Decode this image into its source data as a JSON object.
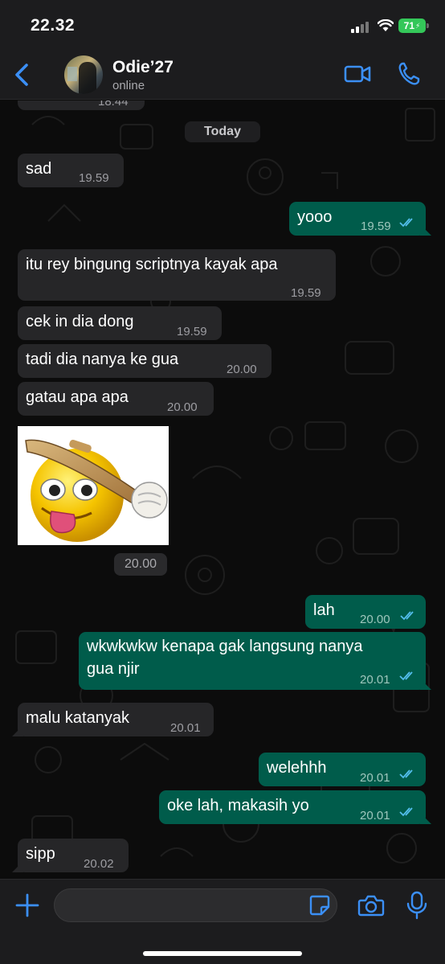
{
  "status_bar": {
    "time": "22.32",
    "battery": "71"
  },
  "header": {
    "name": "Odie’27",
    "status": "online"
  },
  "chat": {
    "partial_time": "18.44",
    "date_label": "Today",
    "messages": [
      {
        "dir": "in",
        "text": "sad",
        "time": "19.59"
      },
      {
        "dir": "out",
        "text": "yooo",
        "time": "19.59"
      },
      {
        "dir": "in",
        "text": "itu rey bingung scriptnya kayak apa",
        "time": "19.59"
      },
      {
        "dir": "in",
        "text": "cek in dia dong",
        "time": "19.59"
      },
      {
        "dir": "in",
        "text": "tadi dia nanya ke gua",
        "time": "20.00"
      },
      {
        "dir": "in",
        "text": "gatau apa apa",
        "time": "20.00"
      },
      {
        "dir": "in",
        "type": "sticker",
        "time": "20.00"
      },
      {
        "dir": "out",
        "text": "lah",
        "time": "20.00"
      },
      {
        "dir": "out",
        "text_line1": "wkwkwkw kenapa gak langsung nanya",
        "text_line2": "gua njir",
        "time": "20.01"
      },
      {
        "dir": "in",
        "text": "malu katanyak",
        "time": "20.01"
      },
      {
        "dir": "out",
        "text": "welehhh",
        "time": "20.01"
      },
      {
        "dir": "out",
        "text": "oke lah, makasih yo",
        "time": "20.01"
      },
      {
        "dir": "in",
        "text": "sipp",
        "time": "20.02"
      }
    ]
  },
  "input": {
    "placeholder": "",
    "value": ""
  },
  "colors": {
    "accent": "#3b8ff6",
    "outgoing": "#005c4b",
    "incoming": "#262628",
    "read_ticks": "#53bdeb"
  },
  "icons": [
    "back-chevron-icon",
    "video-call-icon",
    "phone-icon",
    "plus-icon",
    "sticker-icon",
    "camera-icon",
    "microphone-icon",
    "double-tick-icon"
  ]
}
